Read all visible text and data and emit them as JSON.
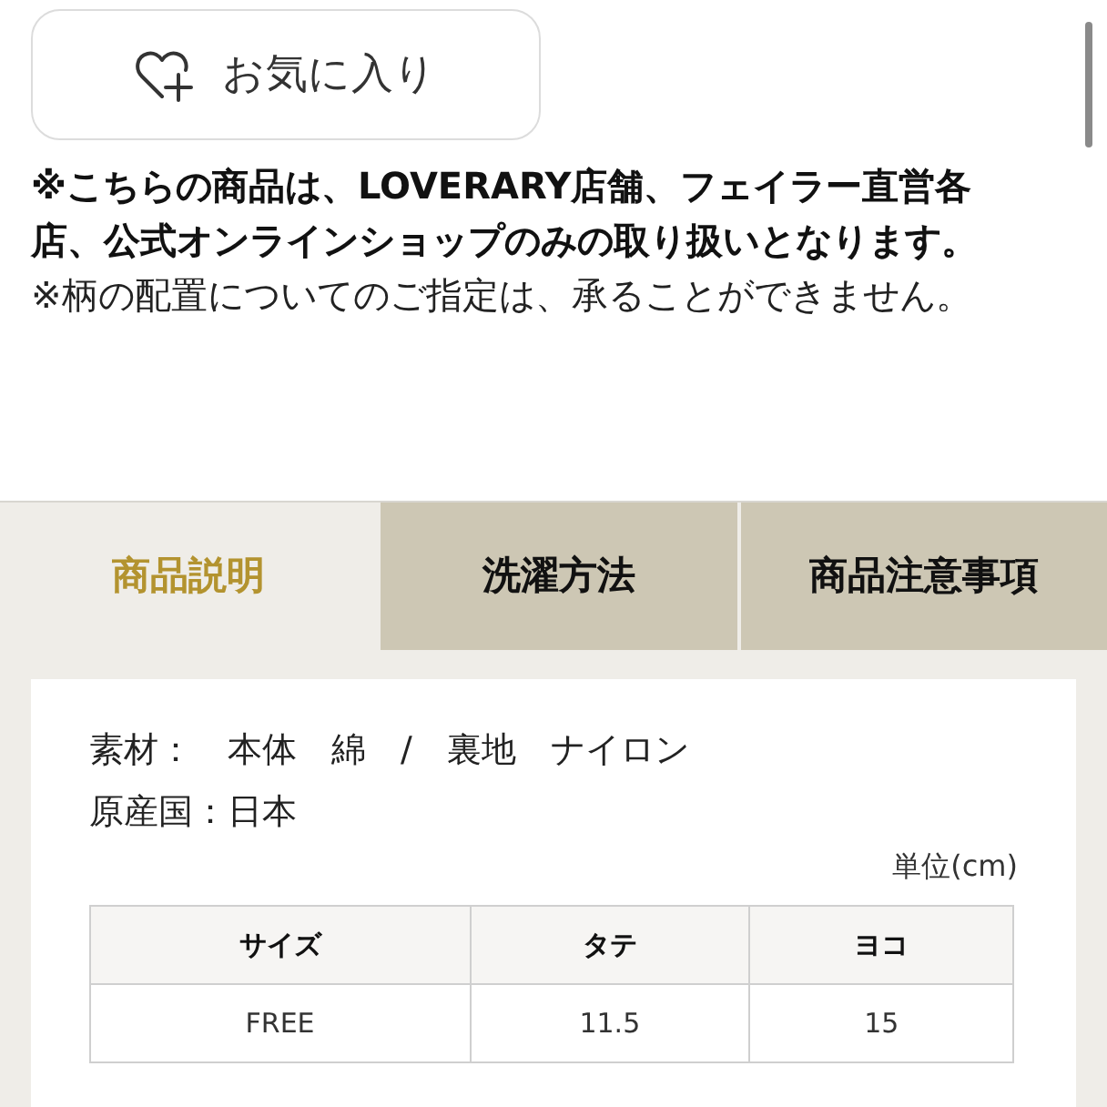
{
  "favorite_button": {
    "label": "お気に入り"
  },
  "notes": [
    {
      "kind": "emphasis",
      "text": "※こちらの商品は、LOVERARY店舗、フェイラー直営各店、公式オンラインショップのみの取り扱いとなります。"
    },
    {
      "kind": "plain",
      "text": "※柄の配置についてのご指定は、承ることができません。"
    }
  ],
  "tabs": [
    {
      "label": "商品説明",
      "selected": true
    },
    {
      "label": "洗濯方法",
      "selected": false
    },
    {
      "label": "商品注意事項",
      "selected": false
    }
  ],
  "description": {
    "lines": [
      "素材：　本体　綿　/　裏地　ナイロン",
      "原産国：日本"
    ],
    "unit": "単位(cm)",
    "table": {
      "columns": [
        "サイズ",
        "タテ",
        "ヨコ"
      ],
      "rows": [
        [
          "FREE",
          "11.5",
          "15"
        ]
      ]
    }
  }
}
